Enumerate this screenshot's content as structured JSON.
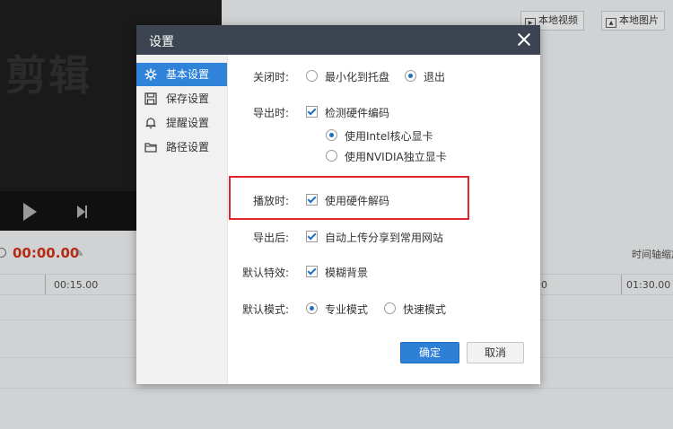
{
  "background": {
    "preview_title": "剪辑",
    "top_buttons": [
      {
        "label": "本地视频",
        "icon": "video-file-icon"
      },
      {
        "label": "本地图片",
        "icon": "image-file-icon"
      }
    ],
    "time_readout": "00:00.00",
    "zoom_label": "时间轴缩放",
    "ruler_labels": [
      "00:15.00",
      "0",
      "01:30.00"
    ]
  },
  "dialog": {
    "title": "设置",
    "sidebar": [
      {
        "label": "基本设置",
        "icon": "gear-icon",
        "active": true
      },
      {
        "label": "保存设置",
        "icon": "save-icon",
        "active": false
      },
      {
        "label": "提醒设置",
        "icon": "bell-icon",
        "active": false
      },
      {
        "label": "路径设置",
        "icon": "folder-icon",
        "active": false
      }
    ],
    "settings": {
      "close": {
        "label": "关闭时:",
        "options": [
          {
            "label": "最小化到托盘",
            "checked": false
          },
          {
            "label": "退出",
            "checked": true
          }
        ]
      },
      "export": {
        "label": "导出时:",
        "checkbox": {
          "label": "检测硬件编码",
          "checked": true
        },
        "options": [
          {
            "label": "使用Intel核心显卡",
            "checked": true
          },
          {
            "label": "使用NVIDIA独立显卡",
            "checked": false
          }
        ]
      },
      "playback": {
        "label": "播放时:",
        "checkbox": {
          "label": "使用硬件解码",
          "checked": true
        }
      },
      "after_export": {
        "label": "导出后:",
        "checkbox": {
          "label": "自动上传分享到常用网站",
          "checked": true
        }
      },
      "default_effect": {
        "label": "默认特效:",
        "checkbox": {
          "label": "模糊背景",
          "checked": true
        }
      },
      "default_mode": {
        "label": "默认模式:",
        "options": [
          {
            "label": "专业模式",
            "checked": true
          },
          {
            "label": "快速模式",
            "checked": false
          }
        ]
      }
    },
    "buttons": {
      "ok": "确定",
      "cancel": "取消"
    }
  },
  "colors": {
    "header": "#3b4450",
    "accent": "#2f84da",
    "highlight_box": "#e0252b",
    "time_readout": "#b52a14"
  }
}
